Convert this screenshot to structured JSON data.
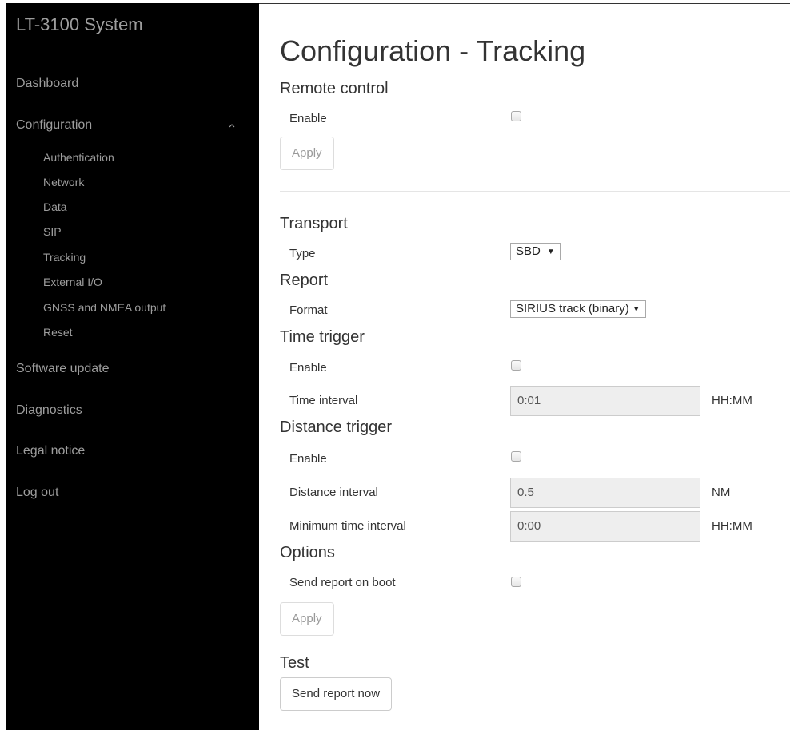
{
  "sidebar": {
    "title": "LT-3100 System",
    "items": [
      {
        "label": "Dashboard"
      },
      {
        "label": "Configuration"
      },
      {
        "label": "Software update"
      },
      {
        "label": "Diagnostics"
      },
      {
        "label": "Legal notice"
      },
      {
        "label": "Log out"
      }
    ],
    "sub_items": [
      {
        "label": "Authentication"
      },
      {
        "label": "Network"
      },
      {
        "label": "Data"
      },
      {
        "label": "SIP"
      },
      {
        "label": "Tracking"
      },
      {
        "label": "External I/O"
      },
      {
        "label": "GNSS and NMEA output"
      },
      {
        "label": "Reset"
      }
    ]
  },
  "page": {
    "title": "Configuration - Tracking",
    "remote_control": {
      "heading": "Remote control",
      "enable_label": "Enable",
      "enable_checked": false,
      "apply_label": "Apply"
    },
    "transport": {
      "heading": "Transport",
      "type_label": "Type",
      "type_value": "SBD"
    },
    "report": {
      "heading": "Report",
      "format_label": "Format",
      "format_value": "SIRIUS track (binary)"
    },
    "time_trigger": {
      "heading": "Time trigger",
      "enable_label": "Enable",
      "enable_checked": false,
      "interval_label": "Time interval",
      "interval_value": "0:01",
      "interval_unit": "HH:MM"
    },
    "distance_trigger": {
      "heading": "Distance trigger",
      "enable_label": "Enable",
      "enable_checked": false,
      "distance_label": "Distance interval",
      "distance_value": "0.5",
      "distance_unit": "NM",
      "min_time_label": "Minimum time interval",
      "min_time_value": "0:00",
      "min_time_unit": "HH:MM"
    },
    "options": {
      "heading": "Options",
      "boot_label": "Send report on boot",
      "boot_checked": false,
      "apply_label": "Apply"
    },
    "test": {
      "heading": "Test",
      "send_label": "Send report now"
    }
  }
}
